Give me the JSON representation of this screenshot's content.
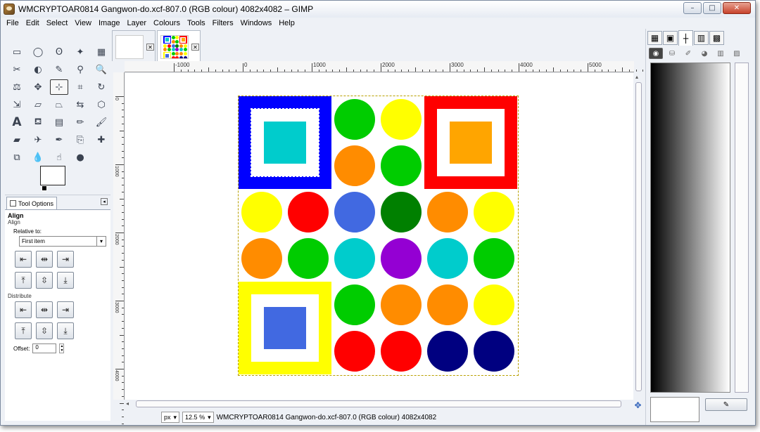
{
  "window": {
    "title": "WMCRYPTOAR0814 Gangwon-do.xcf-807.0 (RGB colour) 4082x4082 – GIMP",
    "controls": {
      "minimize": "–",
      "maximize": "□",
      "close": "✕"
    }
  },
  "menubar": [
    "File",
    "Edit",
    "Select",
    "View",
    "Image",
    "Layer",
    "Colours",
    "Tools",
    "Filters",
    "Windows",
    "Help"
  ],
  "toolbox": {
    "tools": [
      {
        "name": "rect-select-icon",
        "glyph": "▭"
      },
      {
        "name": "ellipse-select-icon",
        "glyph": "◯"
      },
      {
        "name": "free-select-icon",
        "glyph": "ʘ"
      },
      {
        "name": "fuzzy-select-icon",
        "glyph": "✦"
      },
      {
        "name": "color-select-icon",
        "glyph": "▦"
      },
      {
        "name": "scissors-select-icon",
        "glyph": "✂"
      },
      {
        "name": "foreground-select-icon",
        "glyph": "◐"
      },
      {
        "name": "paths-icon",
        "glyph": "✎"
      },
      {
        "name": "color-picker-icon",
        "glyph": "⚲"
      },
      {
        "name": "zoom-icon",
        "glyph": "🔍"
      },
      {
        "name": "measure-icon",
        "glyph": "⚖"
      },
      {
        "name": "move-icon",
        "glyph": "✥"
      },
      {
        "name": "align-icon",
        "glyph": "⊹"
      },
      {
        "name": "crop-icon",
        "glyph": "⌗"
      },
      {
        "name": "rotate-icon",
        "glyph": "↻"
      },
      {
        "name": "scale-icon",
        "glyph": "⇲"
      },
      {
        "name": "shear-icon",
        "glyph": "▱"
      },
      {
        "name": "perspective-icon",
        "glyph": "⏢"
      },
      {
        "name": "flip-icon",
        "glyph": "⇆"
      },
      {
        "name": "cage-icon",
        "glyph": "⬡"
      },
      {
        "name": "text-icon",
        "glyph": "A"
      },
      {
        "name": "bucket-fill-icon",
        "glyph": "⛾"
      },
      {
        "name": "blend-icon",
        "glyph": "▤"
      },
      {
        "name": "pencil-icon",
        "glyph": "✏"
      },
      {
        "name": "paintbrush-icon",
        "glyph": "🖌"
      },
      {
        "name": "eraser-icon",
        "glyph": "▰"
      },
      {
        "name": "airbrush-icon",
        "glyph": "✈"
      },
      {
        "name": "ink-icon",
        "glyph": "✒"
      },
      {
        "name": "clone-icon",
        "glyph": "⎘"
      },
      {
        "name": "heal-icon",
        "glyph": "✚"
      },
      {
        "name": "perspective-clone-icon",
        "glyph": "⧉"
      },
      {
        "name": "blur-icon",
        "glyph": "💧"
      },
      {
        "name": "smudge-icon",
        "glyph": "☝"
      },
      {
        "name": "dodge-burn-icon",
        "glyph": "●"
      }
    ],
    "active_tool_index": 12
  },
  "tool_options": {
    "tab_label": "Tool Options",
    "title": "Align",
    "subtitle": "Align",
    "relative_to_label": "Relative to:",
    "relative_to_value": "First item",
    "distribute_label": "Distribute",
    "offset_label": "Offset:",
    "offset_value": "0",
    "align_buttons": [
      "align-left-edge-icon",
      "align-center-icon",
      "align-right-edge-icon",
      "align-top-edge-icon",
      "align-middle-icon",
      "align-bottom-edge-icon"
    ],
    "distribute_buttons": [
      "distribute-left-icon",
      "distribute-center-icon",
      "distribute-right-icon",
      "distribute-top-icon",
      "distribute-middle-icon",
      "distribute-bottom-icon"
    ]
  },
  "ruler": {
    "h_labels": [
      "-1000",
      "0",
      "1000",
      "2000",
      "3000",
      "4000",
      "5000"
    ],
    "v_labels": [
      "0",
      "1000",
      "2000",
      "3000",
      "4000"
    ]
  },
  "artwork": {
    "squares": [
      {
        "name": "blue-frame-square",
        "outer": "#0000ff",
        "inner": "#00cccc",
        "dashed": true
      },
      {
        "name": "red-frame-square",
        "outer": "#ff0000",
        "inner": "#ffa500",
        "dashed": false
      },
      {
        "name": "yellow-frame-square",
        "outer": "#ffff00",
        "inner": "#4169e1",
        "dashed": false
      }
    ],
    "circle_rows": [
      [
        "",
        "",
        "#00cc00",
        "#ffff00",
        "",
        ""
      ],
      [
        "",
        "",
        "#ff8c00",
        "#00cc00",
        "",
        ""
      ],
      [
        "#ffff00",
        "#ff0000",
        "#4169e1",
        "#008000",
        "#ff8c00",
        "#ffff00"
      ],
      [
        "#ff8c00",
        "#00cc00",
        "#00cccc",
        "#9400d3",
        "#00cccc",
        "#00cc00"
      ],
      [
        "",
        "",
        "#00cc00",
        "#ff8c00",
        "#ff8c00",
        "#ffff00"
      ],
      [
        "",
        "",
        "#ff0000",
        "#ff0000",
        "#000080",
        "#000080"
      ]
    ]
  },
  "statusbar": {
    "unit": "px",
    "zoom": "12.5 %",
    "text": "WMCRYPTOAR0814 Gangwon-do.xcf-807.0 (RGB colour) 4082x4082"
  },
  "right_dock": {
    "top_tabs": [
      "pattern-icon",
      "brush-icon",
      "crosshair-icon",
      "gradient-icon",
      "palette-icon"
    ],
    "sub_tabs": [
      "eye-icon",
      "paint-icon",
      "brush-small-icon",
      "color-wheel-icon",
      "palette-small-icon",
      "image-icon"
    ],
    "gradient": {
      "from": "#000000",
      "to": "#ffffff"
    }
  }
}
